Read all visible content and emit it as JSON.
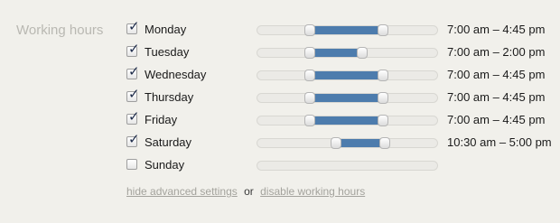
{
  "section": {
    "label": "Working hours"
  },
  "days": [
    {
      "name": "Monday",
      "checked": true,
      "range": "7:00 am – 4:45 pm",
      "start_fraction": 0.292,
      "end_fraction": 0.698
    },
    {
      "name": "Tuesday",
      "checked": true,
      "range": "7:00 am – 2:00 pm",
      "start_fraction": 0.292,
      "end_fraction": 0.583
    },
    {
      "name": "Wednesday",
      "checked": true,
      "range": "7:00 am – 4:45 pm",
      "start_fraction": 0.292,
      "end_fraction": 0.698
    },
    {
      "name": "Thursday",
      "checked": true,
      "range": "7:00 am – 4:45 pm",
      "start_fraction": 0.292,
      "end_fraction": 0.698
    },
    {
      "name": "Friday",
      "checked": true,
      "range": "7:00 am – 4:45 pm",
      "start_fraction": 0.292,
      "end_fraction": 0.698
    },
    {
      "name": "Saturday",
      "checked": true,
      "range": "10:30 am – 5:00 pm",
      "start_fraction": 0.438,
      "end_fraction": 0.708
    },
    {
      "name": "Sunday",
      "checked": false,
      "range": "",
      "start_fraction": null,
      "end_fraction": null
    }
  ],
  "footer": {
    "hide_advanced": "hide advanced settings",
    "or": "or",
    "disable": "disable working hours"
  },
  "colors": {
    "background": "#f1f0eb",
    "slider_fill": "#4d7cad",
    "section_label": "#b9b8b2",
    "footer_link": "#a4a39d"
  }
}
